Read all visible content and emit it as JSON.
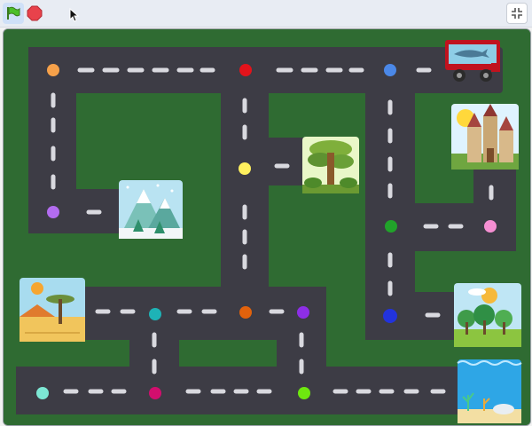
{
  "toolbar": {
    "green_flag_icon": "green-flag-icon",
    "stop_icon": "stop-icon",
    "fullscreen_icon": "exit-fullscreen-icon"
  },
  "colors": {
    "grass": "#2f6b32",
    "road": "#3d3c45",
    "dash": "#d9d9df",
    "truck_body": "#c0121e",
    "dots": [
      "#f6a14a",
      "#e3131b",
      "#4b88e8",
      "#fff05e",
      "#b36cf0",
      "#f58fd2",
      "#21a32a",
      "#2233dd",
      "#1eb3b6",
      "#e2620c",
      "#8d2ee6",
      "#7de7d4",
      "#d20e6e",
      "#6ee80f"
    ]
  },
  "scene": {
    "landmarks": [
      "snowy-mountains",
      "jungle-tree",
      "castle",
      "savanna-tree",
      "forest-meadow",
      "underwater"
    ],
    "vehicle": "shark-truck"
  }
}
